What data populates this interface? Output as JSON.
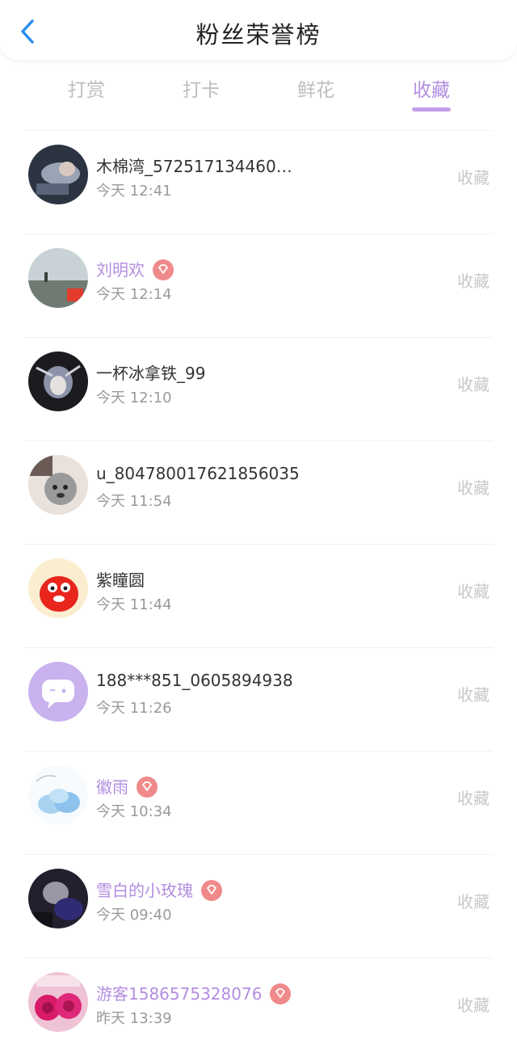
{
  "header": {
    "title": "粉丝荣誉榜"
  },
  "tabs": [
    {
      "label": "打赏",
      "active": false
    },
    {
      "label": "打卡",
      "active": false
    },
    {
      "label": "鲜花",
      "active": false
    },
    {
      "label": "收藏",
      "active": true
    }
  ],
  "colors": {
    "accent": "#b38ee0",
    "badge": "#f08a8a"
  },
  "fans": [
    {
      "name": "木棉湾_572517134460…",
      "time": "今天 12:41",
      "action": "收藏",
      "vip": false
    },
    {
      "name": "刘明欢",
      "time": "今天 12:14",
      "action": "收藏",
      "vip": true
    },
    {
      "name": "一杯冰拿铁_99",
      "time": "今天 12:10",
      "action": "收藏",
      "vip": false
    },
    {
      "name": "u_804780017621856035",
      "time": "今天 11:54",
      "action": "收藏",
      "vip": false
    },
    {
      "name": "紫瞳圆",
      "time": "今天 11:44",
      "action": "收藏",
      "vip": false
    },
    {
      "name": "188***851_0605894938",
      "time": "今天 11:26",
      "action": "收藏",
      "vip": false
    },
    {
      "name": "徽雨",
      "time": "今天 10:34",
      "action": "收藏",
      "vip": true
    },
    {
      "name": "雪白的小玫瑰",
      "time": "今天 09:40",
      "action": "收藏",
      "vip": true
    },
    {
      "name": "游客1586575328076",
      "time": "昨天 13:39",
      "action": "收藏",
      "vip": true
    }
  ]
}
